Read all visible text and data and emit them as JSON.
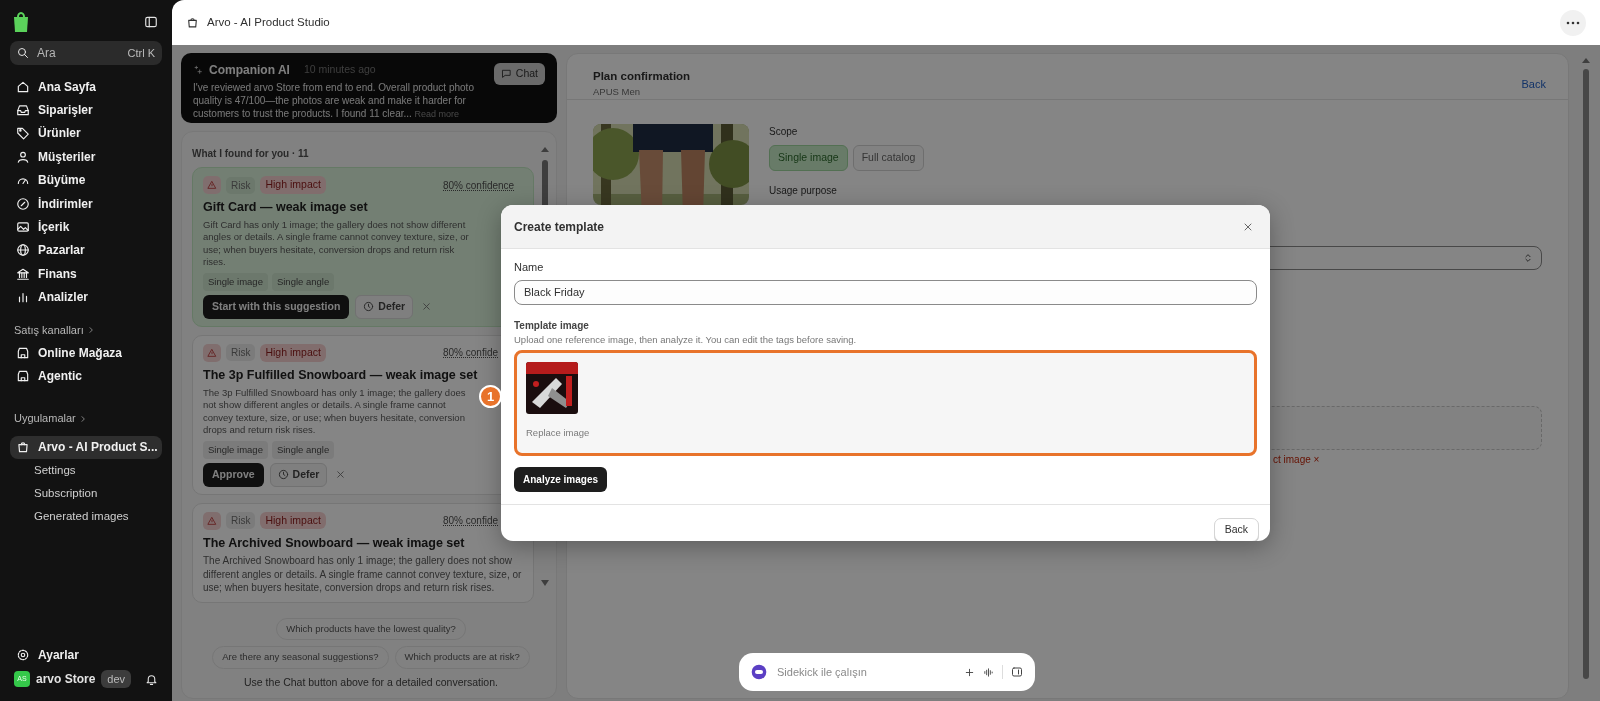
{
  "sidebar": {
    "search": {
      "placeholder": "Ara",
      "shortcut": "Ctrl K"
    },
    "nav_items": [
      {
        "label": "Ana Sayfa"
      },
      {
        "label": "Siparişler"
      },
      {
        "label": "Ürünler"
      },
      {
        "label": "Müşteriler"
      },
      {
        "label": "Büyüme"
      },
      {
        "label": "İndirimler"
      },
      {
        "label": "İçerik"
      },
      {
        "label": "Pazarlar"
      },
      {
        "label": "Finans"
      },
      {
        "label": "Analizler"
      }
    ],
    "sales_channels": {
      "heading": "Satış kanalları",
      "items": [
        {
          "label": "Online Mağaza"
        },
        {
          "label": "Agentic"
        }
      ]
    },
    "apps": {
      "heading": "Uygulamalar",
      "items": [
        {
          "label": "Arvo - AI Product S...",
          "selected": true,
          "children": [
            {
              "label": "Settings"
            },
            {
              "label": "Subscription"
            },
            {
              "label": "Generated images"
            }
          ]
        }
      ]
    },
    "settings": "Ayarlar",
    "store": {
      "avatar": "AS",
      "name": "arvo Store",
      "badge": "dev"
    }
  },
  "top_bar": {
    "title": "Arvo - AI Product Studio"
  },
  "companion": {
    "title": "Companion AI",
    "time": "10 minutes ago",
    "message": "I've reviewed arvo Store from end to end. Overall product photo quality is 47/100—the photos are weak and make it harder for customers to trust the products. I found 11 clear...",
    "read_more": "Read more",
    "chat_button": "Chat"
  },
  "findings": {
    "heading": "What I found for you · 11",
    "cards": [
      {
        "highlighted": true,
        "type": "Risk",
        "impact": "High impact",
        "confidence": "80% confidence",
        "title": "Gift Card — weak image set",
        "description": "Gift Card has only 1 image; the gallery does not show different angles or details. A single frame cannot convey texture, size, or use; when buyers hesitate, conversion drops and return risk rises.",
        "tags": [
          "Single image",
          "Single angle"
        ],
        "primary_button": "Start with this suggestion",
        "defer_button": "Defer"
      },
      {
        "highlighted": false,
        "type": "Risk",
        "impact": "High impact",
        "confidence": "80% confide",
        "title": "The 3p Fulfilled Snowboard — weak image set",
        "description": "The 3p Fulfilled Snowboard has only 1 image; the gallery does not show different angles or details. A single frame cannot convey texture, size, or use; when buyers hesitate, conversion drops and return risk rises.",
        "tags": [
          "Single image",
          "Single angle"
        ],
        "primary_button": "Approve",
        "defer_button": "Defer"
      },
      {
        "highlighted": false,
        "type": "Risk",
        "impact": "High impact",
        "confidence": "80% confide",
        "title": "The Archived Snowboard — weak image set",
        "description": "The Archived Snowboard has only 1 image; the gallery does not show different angles or details. A single frame cannot convey texture, size, or use; when buyers hesitate, conversion drops and return risk rises."
      }
    ]
  },
  "suggestions": [
    "Which products have the lowest quality?",
    "Are there any seasonal suggestions?",
    "Which products are at risk?"
  ],
  "chat_hint": "Use the Chat button above for a detailed conversation.",
  "plan": {
    "title": "Plan confirmation",
    "subtitle": "APUS Men",
    "back_link": "Back",
    "scope_label": "Scope",
    "scope_options": [
      {
        "label": "Single image",
        "selected": true
      },
      {
        "label": "Full catalog",
        "selected": false
      }
    ],
    "usage_label": "Usage purpose",
    "error_text": "ct image ×"
  },
  "modal": {
    "title": "Create template",
    "name_label": "Name",
    "name_value": "Black Friday",
    "image_label": "Template image",
    "image_hint": "Upload one reference image, then analyze it. You can edit the tags before saving.",
    "replace_link": "Replace image",
    "analyze_button": "Analyze images",
    "back_button": "Back"
  },
  "step_marker": "1",
  "sidekick": {
    "placeholder": "Sidekick ile çalışın"
  }
}
